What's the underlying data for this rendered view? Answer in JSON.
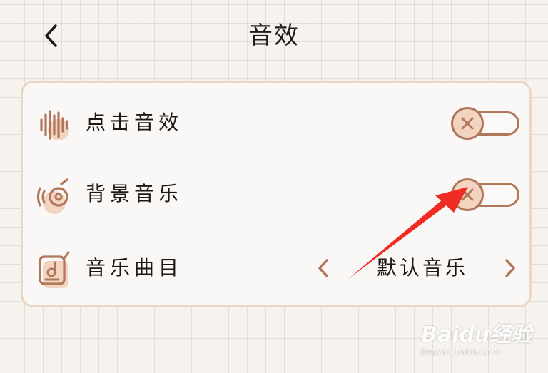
{
  "header": {
    "title": "音效",
    "back_icon": "chevron-left-icon"
  },
  "settings": {
    "click_sound": {
      "icon": "sound-wave-icon",
      "label": "点击音效",
      "enabled": false
    },
    "background_music": {
      "icon": "vinyl-record-icon",
      "label": "背景音乐",
      "enabled": false
    },
    "music_track": {
      "icon": "music-file-icon",
      "label": "音乐曲目",
      "value": "默认音乐",
      "prev_icon": "chevron-left-icon",
      "next_icon": "chevron-right-icon"
    }
  },
  "colors": {
    "accent": "#b0775a",
    "knob_fill": "#f2d4c1",
    "panel_border": "#ecd7c2",
    "annotation_arrow": "#ef2b23"
  },
  "watermark": {
    "logo": "Baidu经验",
    "url": "jingyan.baidu.com"
  }
}
